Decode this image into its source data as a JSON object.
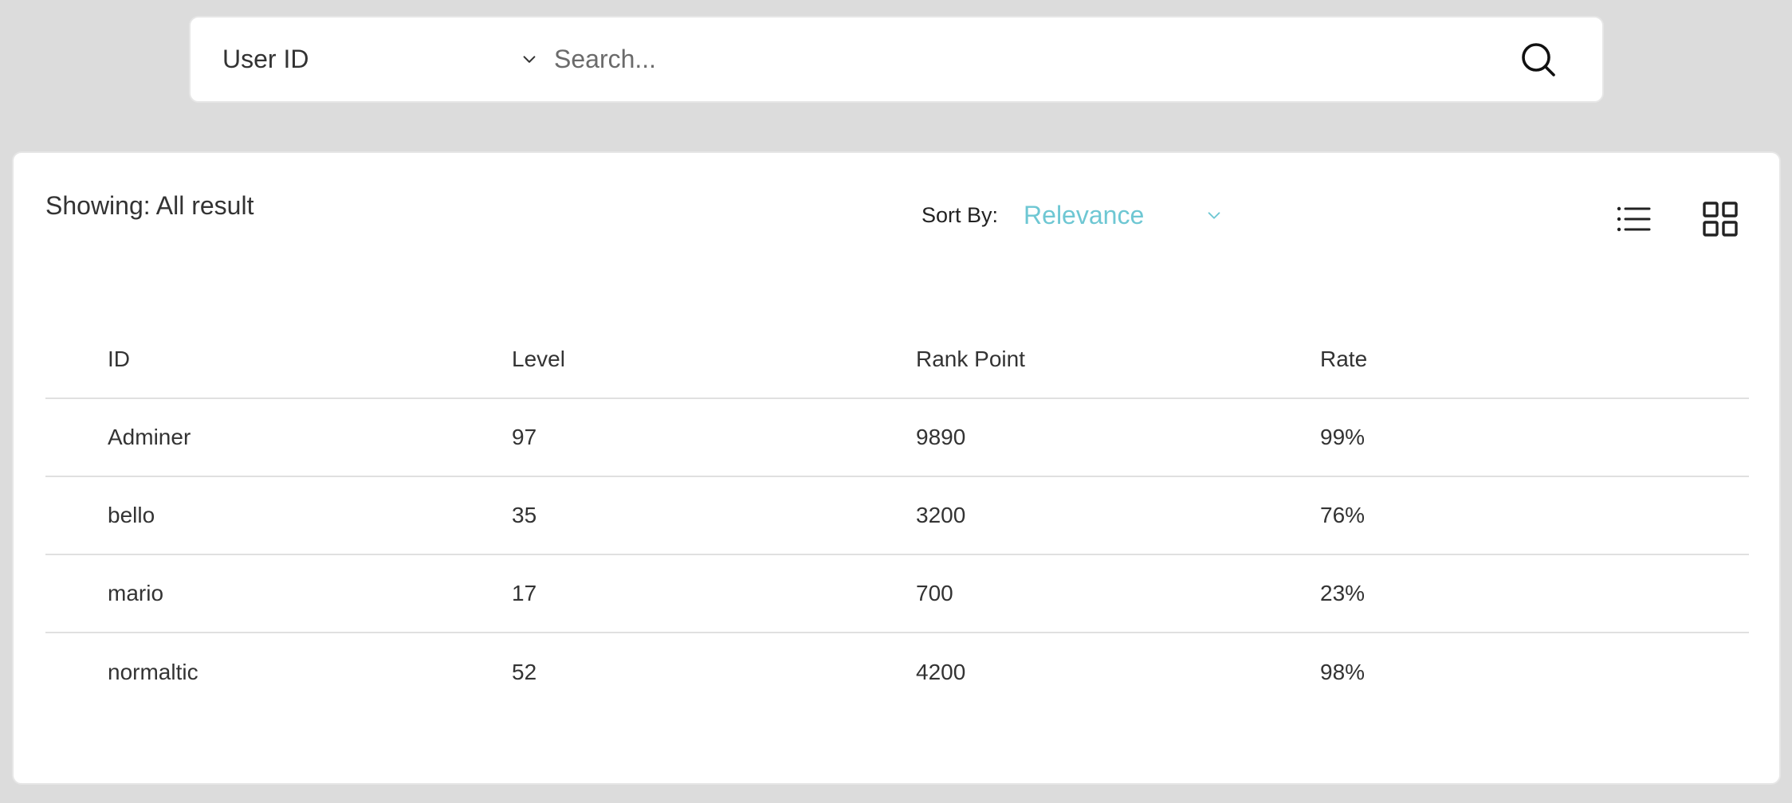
{
  "search": {
    "type_label": "User ID",
    "placeholder": "Search...",
    "value": ""
  },
  "results": {
    "showing_label": "Showing: All result",
    "sort_label": "Sort By:",
    "sort_value": "Relevance",
    "accent_color": "#6ec7d3",
    "view_modes": [
      "list-icon",
      "grid-icon"
    ]
  },
  "table": {
    "headers": [
      "ID",
      "Level",
      "Rank Point",
      "Rate"
    ],
    "rows": [
      [
        "Adminer",
        "97",
        "9890",
        "99%"
      ],
      [
        "bello",
        "35",
        "3200",
        "76%"
      ],
      [
        "mario",
        "17",
        "700",
        "23%"
      ],
      [
        "normaltic",
        "52",
        "4200",
        "98%"
      ]
    ]
  }
}
